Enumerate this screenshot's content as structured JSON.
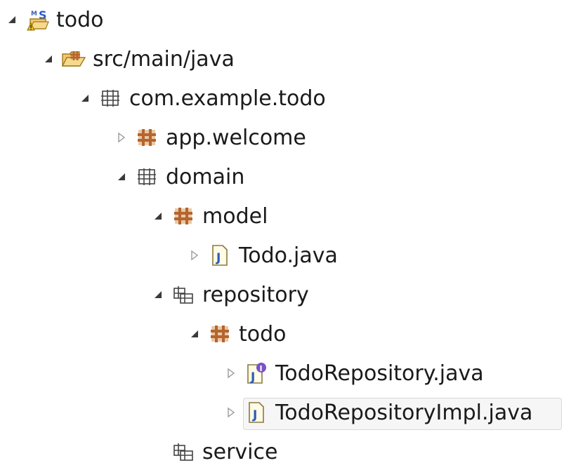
{
  "tree": [
    {
      "label": "todo",
      "depth": 0,
      "expander": "expanded",
      "icon": "spring-maven-project-icon",
      "selected": false
    },
    {
      "label": "src/main/java",
      "depth": 1,
      "expander": "expanded",
      "icon": "source-folder-icon",
      "selected": false
    },
    {
      "label": "com.example.todo",
      "depth": 2,
      "expander": "expanded",
      "icon": "empty-package-icon",
      "selected": false
    },
    {
      "label": "app.welcome",
      "depth": 3,
      "expander": "collapsed",
      "icon": "package-icon",
      "selected": false
    },
    {
      "label": "domain",
      "depth": 3,
      "expander": "expanded",
      "icon": "empty-package-icon",
      "selected": false
    },
    {
      "label": "model",
      "depth": 4,
      "expander": "expanded",
      "icon": "package-icon",
      "selected": false
    },
    {
      "label": "Todo.java",
      "depth": 5,
      "expander": "collapsed",
      "icon": "java-file-icon",
      "selected": false
    },
    {
      "label": "repository",
      "depth": 4,
      "expander": "expanded",
      "icon": "folder-package-icon",
      "selected": false
    },
    {
      "label": "todo",
      "depth": 5,
      "expander": "expanded",
      "icon": "package-icon",
      "selected": false
    },
    {
      "label": "TodoRepository.java",
      "depth": 6,
      "expander": "collapsed",
      "icon": "java-interface-file-icon",
      "selected": false
    },
    {
      "label": "TodoRepositoryImpl.java",
      "depth": 6,
      "expander": "collapsed",
      "icon": "java-file-icon",
      "selected": true
    },
    {
      "label": "service",
      "depth": 4,
      "expander": "none",
      "icon": "folder-package-icon",
      "selected": false
    }
  ],
  "colors": {
    "package_brown": "#b5652f",
    "package_fill": "#d99a5a",
    "java_blue": "#2a5bb5",
    "selection_bg": "#f6f6f6",
    "selection_border": "#d8d8d8"
  }
}
